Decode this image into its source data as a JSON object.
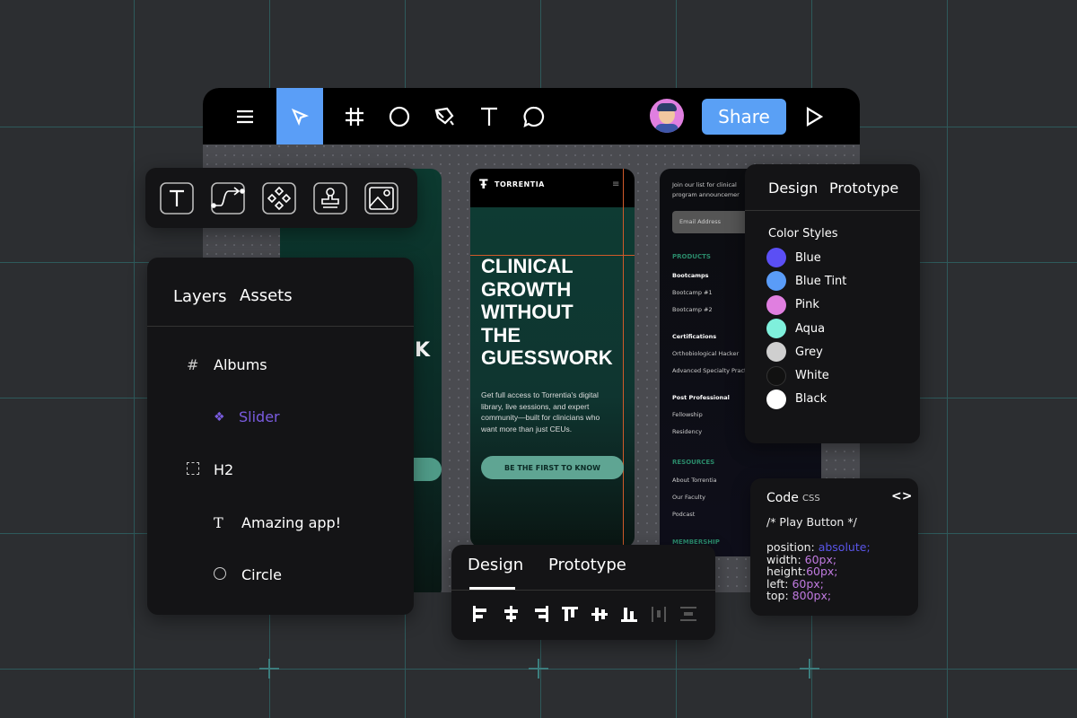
{
  "toolbar": {
    "share_label": "Share",
    "tools": [
      "menu-icon",
      "pointer-icon",
      "frame-icon",
      "ellipse-icon",
      "pen-icon",
      "text-icon",
      "comment-icon"
    ]
  },
  "shape_tools": [
    "text-box-icon",
    "connector-icon",
    "component-icon",
    "stamp-icon",
    "image-icon"
  ],
  "layers_panel": {
    "tabs": [
      "Layers",
      "Assets"
    ],
    "items": [
      {
        "icon": "frame-icon",
        "label": "Albums"
      },
      {
        "icon": "component-icon",
        "label": "Slider"
      },
      {
        "icon": "selection-icon",
        "label": "H2"
      },
      {
        "icon": "text-icon",
        "label": "Amazing app!"
      },
      {
        "icon": "circle-icon",
        "label": "Circle"
      }
    ]
  },
  "phone_left": {
    "partial_heading": "K"
  },
  "phone_mid": {
    "brand": "TORRENTIA",
    "headline": [
      "CLINICAL",
      "GROWTH",
      "WITHOUT",
      "THE",
      "GUESSWORK"
    ],
    "body": "Get full access to Torrentia's digital library, live sessions, and expert community—built for clinicians who want more than just CEUs.",
    "cta": "BE THE FIRST TO KNOW"
  },
  "phone_right": {
    "intro": [
      "Join our list for clinical",
      "program announcemer"
    ],
    "email_placeholder": "Email Address",
    "products": "PRODUCTS",
    "bootcamps": "Bootcamps",
    "bootcamp1": "Bootcamp #1",
    "bootcamp2": "Bootcamp #2",
    "certifications": "Certifications",
    "cert1": "Orthobiological Hacker",
    "cert2": "Advanced Specialty Pract",
    "post": "Post Professional",
    "fellowship": "Fellowship",
    "residency": "Residency",
    "resources": "RESOURCES",
    "about": "About Torrentia",
    "faculty": "Our Faculty",
    "podcast": "Podcast",
    "membership": "MEMBERSHIP"
  },
  "design_panel": {
    "tabs": [
      "Design",
      "Prototype"
    ],
    "section": "Color Styles",
    "colors": [
      {
        "name": "Blue",
        "hex": "#5b4ff5"
      },
      {
        "name": "Blue Tint",
        "hex": "#5a9cf8"
      },
      {
        "name": "Pink",
        "hex": "#e07fe0"
      },
      {
        "name": "Aqua",
        "hex": "#7ff0dc"
      },
      {
        "name": "Grey",
        "hex": "#cfcfcf"
      },
      {
        "name": "White",
        "hex": "#111111"
      },
      {
        "name": "Black",
        "hex": "#ffffff"
      }
    ]
  },
  "code_panel": {
    "title": "Code",
    "lang": "CSS",
    "comment": "/* Play Button */",
    "lines": [
      {
        "prop": "position: ",
        "val": "absolute;"
      },
      {
        "prop": "width: ",
        "val": "60px;"
      },
      {
        "prop": "height:",
        "val": "60px;"
      },
      {
        "prop": "left: ",
        "val": "60px;"
      },
      {
        "prop": "top: ",
        "val": "800px;"
      }
    ]
  },
  "bottom_panel": {
    "tabs": [
      "Design",
      "Prototype"
    ],
    "align_tools": [
      "align-left",
      "align-h-center",
      "align-right",
      "align-top",
      "align-v-center",
      "align-bottom",
      "distribute-h",
      "distribute-v"
    ]
  }
}
